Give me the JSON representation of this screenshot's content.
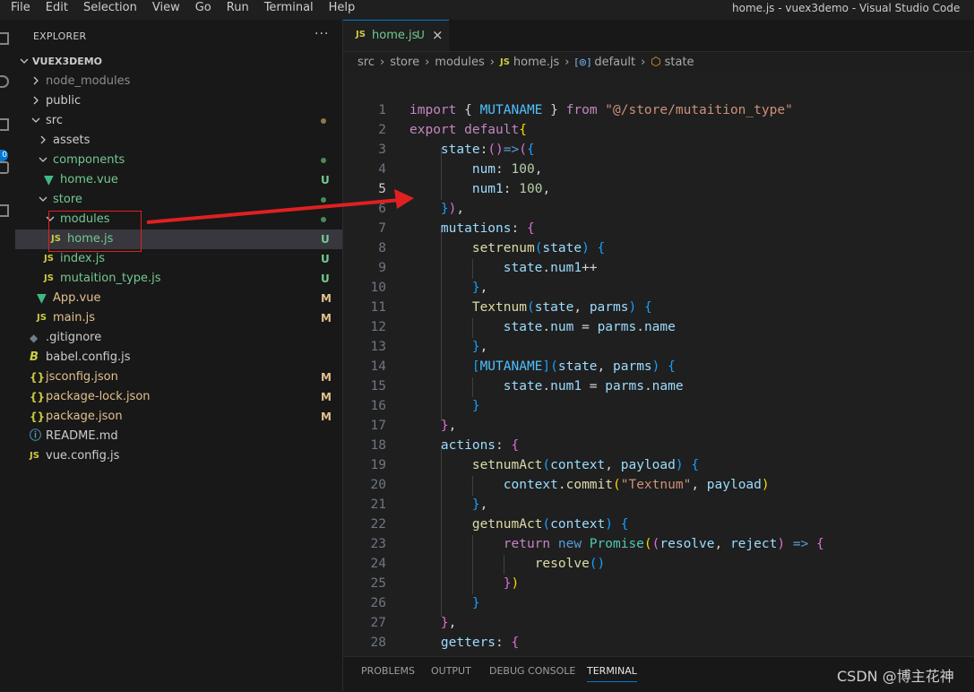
{
  "menu": [
    "File",
    "Edit",
    "Selection",
    "View",
    "Go",
    "Run",
    "Terminal",
    "Help"
  ],
  "window_title": "home.js - vuex3demo - Visual Studio Code",
  "activity": {
    "badge": "0"
  },
  "explorer": {
    "title": "EXPLORER",
    "more": "···",
    "root": "VUEX3DEMO",
    "items": [
      {
        "name": "node_modules",
        "type": "folder",
        "open": false,
        "depth": 1,
        "color": "#8c8c8c",
        "badge": "",
        "dot": ""
      },
      {
        "name": "public",
        "type": "folder",
        "open": false,
        "depth": 1,
        "color": "#cccccc",
        "badge": "",
        "dot": ""
      },
      {
        "name": "src",
        "type": "folder",
        "open": true,
        "depth": 1,
        "color": "#cccccc",
        "badge": "",
        "dot": "#8c7a4e"
      },
      {
        "name": "assets",
        "type": "folder",
        "open": false,
        "depth": 2,
        "color": "#cccccc",
        "badge": "",
        "dot": ""
      },
      {
        "name": "components",
        "type": "folder",
        "open": true,
        "depth": 2,
        "color": "#73c991",
        "badge": "",
        "dot": "#4a8a5a"
      },
      {
        "name": "home.vue",
        "type": "vue",
        "depth": 3,
        "color": "#73c991",
        "badge": "U",
        "badge_color": "#73c991",
        "dot": ""
      },
      {
        "name": "store",
        "type": "folder",
        "open": true,
        "depth": 2,
        "color": "#73c991",
        "badge": "",
        "dot": "#4a8a5a"
      },
      {
        "name": "modules",
        "type": "folder",
        "open": true,
        "depth": 3,
        "color": "#73c991",
        "badge": "",
        "dot": "#4a8a5a"
      },
      {
        "name": "home.js",
        "type": "js",
        "depth": 4,
        "color": "#73c991",
        "badge": "U",
        "badge_color": "#73c991",
        "dot": "",
        "selected": true
      },
      {
        "name": "index.js",
        "type": "js",
        "depth": 3,
        "color": "#73c991",
        "badge": "U",
        "badge_color": "#73c991",
        "dot": ""
      },
      {
        "name": "mutaition_type.js",
        "type": "js",
        "depth": 3,
        "color": "#73c991",
        "badge": "U",
        "badge_color": "#73c991",
        "dot": ""
      },
      {
        "name": "App.vue",
        "type": "vue",
        "depth": 2,
        "color": "#e2c08d",
        "badge": "M",
        "badge_color": "#e2c08d",
        "dot": ""
      },
      {
        "name": "main.js",
        "type": "js",
        "depth": 2,
        "color": "#e2c08d",
        "badge": "M",
        "badge_color": "#e2c08d",
        "dot": ""
      },
      {
        "name": ".gitignore",
        "type": "git",
        "depth": 1,
        "color": "#cccccc",
        "badge": "",
        "dot": ""
      },
      {
        "name": "babel.config.js",
        "type": "babel",
        "depth": 1,
        "color": "#cccccc",
        "badge": "",
        "dot": ""
      },
      {
        "name": "jsconfig.json",
        "type": "json",
        "depth": 1,
        "color": "#e2c08d",
        "badge": "M",
        "badge_color": "#e2c08d",
        "dot": ""
      },
      {
        "name": "package-lock.json",
        "type": "json",
        "depth": 1,
        "color": "#e2c08d",
        "badge": "M",
        "badge_color": "#e2c08d",
        "dot": ""
      },
      {
        "name": "package.json",
        "type": "json",
        "depth": 1,
        "color": "#e2c08d",
        "badge": "M",
        "badge_color": "#e2c08d",
        "dot": ""
      },
      {
        "name": "README.md",
        "type": "info",
        "depth": 1,
        "color": "#cccccc",
        "badge": "",
        "dot": ""
      },
      {
        "name": "vue.config.js",
        "type": "js",
        "depth": 1,
        "color": "#cccccc",
        "badge": "",
        "dot": ""
      }
    ]
  },
  "tab": {
    "icon": "JS",
    "name": "home.js",
    "status": "U",
    "close": "×"
  },
  "breadcrumb": {
    "parts": [
      "src",
      "store",
      "modules"
    ],
    "file": "home.js",
    "symbol1": "default",
    "symbol2": "state"
  },
  "editor": {
    "active_line": 5,
    "lines": [
      {
        "n": 1,
        "tokens": [
          [
            "import ",
            "c"
          ],
          [
            "{ ",
            "p"
          ],
          [
            "MUTANAME",
            "cst"
          ],
          [
            " } ",
            "p"
          ],
          [
            "from ",
            "c"
          ],
          [
            "\"@/store/mutaition_type\"",
            "s"
          ]
        ]
      },
      {
        "n": 2,
        "tokens": [
          [
            "export ",
            "c"
          ],
          [
            "default",
            "c"
          ],
          [
            "{",
            "b1"
          ]
        ]
      },
      {
        "n": 3,
        "tokens": [
          [
            "    ",
            "p"
          ],
          [
            "state",
            "v"
          ],
          [
            ":",
            "p"
          ],
          [
            "()",
            "b2"
          ],
          [
            "=>",
            "k"
          ],
          [
            "(",
            "b2"
          ],
          [
            "{",
            "b3"
          ]
        ]
      },
      {
        "n": 4,
        "tokens": [
          [
            "        ",
            "p"
          ],
          [
            "num",
            "v"
          ],
          [
            ": ",
            "p"
          ],
          [
            "100",
            "n"
          ],
          [
            ",",
            "p"
          ]
        ]
      },
      {
        "n": 5,
        "tokens": [
          [
            "        ",
            "p"
          ],
          [
            "num1",
            "v"
          ],
          [
            ": ",
            "p"
          ],
          [
            "100",
            "n"
          ],
          [
            ",",
            "p"
          ]
        ]
      },
      {
        "n": 6,
        "tokens": [
          [
            "    ",
            "p"
          ],
          [
            "}",
            "b3"
          ],
          [
            ")",
            "b2"
          ],
          [
            ",",
            "p"
          ]
        ]
      },
      {
        "n": 7,
        "tokens": [
          [
            "    ",
            "p"
          ],
          [
            "mutations",
            "v"
          ],
          [
            ": ",
            "p"
          ],
          [
            "{",
            "b2"
          ]
        ]
      },
      {
        "n": 8,
        "tokens": [
          [
            "        ",
            "p"
          ],
          [
            "setrenum",
            "f"
          ],
          [
            "(",
            "b3"
          ],
          [
            "state",
            "v"
          ],
          [
            ") ",
            "b3"
          ],
          [
            "{",
            "b3"
          ]
        ]
      },
      {
        "n": 9,
        "tokens": [
          [
            "            ",
            "p"
          ],
          [
            "state",
            "v"
          ],
          [
            ".",
            "p"
          ],
          [
            "num1",
            "v"
          ],
          [
            "++",
            "p"
          ]
        ]
      },
      {
        "n": 10,
        "tokens": [
          [
            "        ",
            "p"
          ],
          [
            "}",
            "b3"
          ],
          [
            ",",
            "p"
          ]
        ]
      },
      {
        "n": 11,
        "tokens": [
          [
            "        ",
            "p"
          ],
          [
            "Textnum",
            "f"
          ],
          [
            "(",
            "b3"
          ],
          [
            "state",
            "v"
          ],
          [
            ", ",
            "p"
          ],
          [
            "parms",
            "v"
          ],
          [
            ") ",
            "b3"
          ],
          [
            "{",
            "b3"
          ]
        ]
      },
      {
        "n": 12,
        "tokens": [
          [
            "            ",
            "p"
          ],
          [
            "state",
            "v"
          ],
          [
            ".",
            "p"
          ],
          [
            "num",
            "v"
          ],
          [
            " = ",
            "p"
          ],
          [
            "parms",
            "v"
          ],
          [
            ".",
            "p"
          ],
          [
            "name",
            "v"
          ]
        ]
      },
      {
        "n": 13,
        "tokens": [
          [
            "        ",
            "p"
          ],
          [
            "}",
            "b3"
          ],
          [
            ",",
            "p"
          ]
        ]
      },
      {
        "n": 14,
        "tokens": [
          [
            "        ",
            "p"
          ],
          [
            "[",
            "b3"
          ],
          [
            "MUTANAME",
            "cst"
          ],
          [
            "]",
            "b3"
          ],
          [
            "(",
            "b3"
          ],
          [
            "state",
            "v"
          ],
          [
            ", ",
            "p"
          ],
          [
            "parms",
            "v"
          ],
          [
            ") ",
            "b3"
          ],
          [
            "{",
            "b3"
          ]
        ]
      },
      {
        "n": 15,
        "tokens": [
          [
            "            ",
            "p"
          ],
          [
            "state",
            "v"
          ],
          [
            ".",
            "p"
          ],
          [
            "num1",
            "v"
          ],
          [
            " = ",
            "p"
          ],
          [
            "parms",
            "v"
          ],
          [
            ".",
            "p"
          ],
          [
            "name",
            "v"
          ]
        ]
      },
      {
        "n": 16,
        "tokens": [
          [
            "        ",
            "p"
          ],
          [
            "}",
            "b3"
          ]
        ]
      },
      {
        "n": 17,
        "tokens": [
          [
            "    ",
            "p"
          ],
          [
            "}",
            "b2"
          ],
          [
            ",",
            "p"
          ]
        ]
      },
      {
        "n": 18,
        "tokens": [
          [
            "    ",
            "p"
          ],
          [
            "actions",
            "v"
          ],
          [
            ": ",
            "p"
          ],
          [
            "{",
            "b2"
          ]
        ]
      },
      {
        "n": 19,
        "tokens": [
          [
            "        ",
            "p"
          ],
          [
            "setnumAct",
            "f"
          ],
          [
            "(",
            "b3"
          ],
          [
            "context",
            "v"
          ],
          [
            ", ",
            "p"
          ],
          [
            "payload",
            "v"
          ],
          [
            ") ",
            "b3"
          ],
          [
            "{",
            "b3"
          ]
        ]
      },
      {
        "n": 20,
        "tokens": [
          [
            "            ",
            "p"
          ],
          [
            "context",
            "v"
          ],
          [
            ".",
            "p"
          ],
          [
            "commit",
            "f"
          ],
          [
            "(",
            "b1"
          ],
          [
            "\"Textnum\"",
            "s"
          ],
          [
            ", ",
            "p"
          ],
          [
            "payload",
            "v"
          ],
          [
            ")",
            "b1"
          ]
        ]
      },
      {
        "n": 21,
        "tokens": [
          [
            "        ",
            "p"
          ],
          [
            "}",
            "b3"
          ],
          [
            ",",
            "p"
          ]
        ]
      },
      {
        "n": 22,
        "tokens": [
          [
            "        ",
            "p"
          ],
          [
            "getnumAct",
            "f"
          ],
          [
            "(",
            "b3"
          ],
          [
            "context",
            "v"
          ],
          [
            ") ",
            "b3"
          ],
          [
            "{",
            "b3"
          ]
        ]
      },
      {
        "n": 23,
        "tokens": [
          [
            "            ",
            "p"
          ],
          [
            "return ",
            "c"
          ],
          [
            "new ",
            "k"
          ],
          [
            "Promise",
            "t"
          ],
          [
            "(",
            "b1"
          ],
          [
            "(",
            "b2"
          ],
          [
            "resolve",
            "v"
          ],
          [
            ", ",
            "p"
          ],
          [
            "reject",
            "v"
          ],
          [
            ") ",
            "b2"
          ],
          [
            "=> ",
            "k"
          ],
          [
            "{",
            "b2"
          ]
        ]
      },
      {
        "n": 24,
        "tokens": [
          [
            "                ",
            "p"
          ],
          [
            "resolve",
            "f"
          ],
          [
            "()",
            "b3"
          ]
        ]
      },
      {
        "n": 25,
        "tokens": [
          [
            "            ",
            "p"
          ],
          [
            "}",
            "b2"
          ],
          [
            ")",
            "b1"
          ]
        ]
      },
      {
        "n": 26,
        "tokens": [
          [
            "        ",
            "p"
          ],
          [
            "}",
            "b3"
          ]
        ]
      },
      {
        "n": 27,
        "tokens": [
          [
            "    ",
            "p"
          ],
          [
            "}",
            "b2"
          ],
          [
            ",",
            "p"
          ]
        ]
      },
      {
        "n": 28,
        "tokens": [
          [
            "    ",
            "p"
          ],
          [
            "getters",
            "v"
          ],
          [
            ": ",
            "p"
          ],
          [
            "{",
            "b2"
          ]
        ]
      }
    ]
  },
  "panel": {
    "tabs": [
      "PROBLEMS",
      "OUTPUT",
      "DEBUG CONSOLE",
      "TERMINAL"
    ],
    "active": "TERMINAL"
  },
  "watermark": "CSDN @博主花神",
  "colors": {
    "accent": "#0078d4",
    "untracked": "#73c991",
    "modified": "#e2c08d",
    "annotation": "#e02020"
  }
}
